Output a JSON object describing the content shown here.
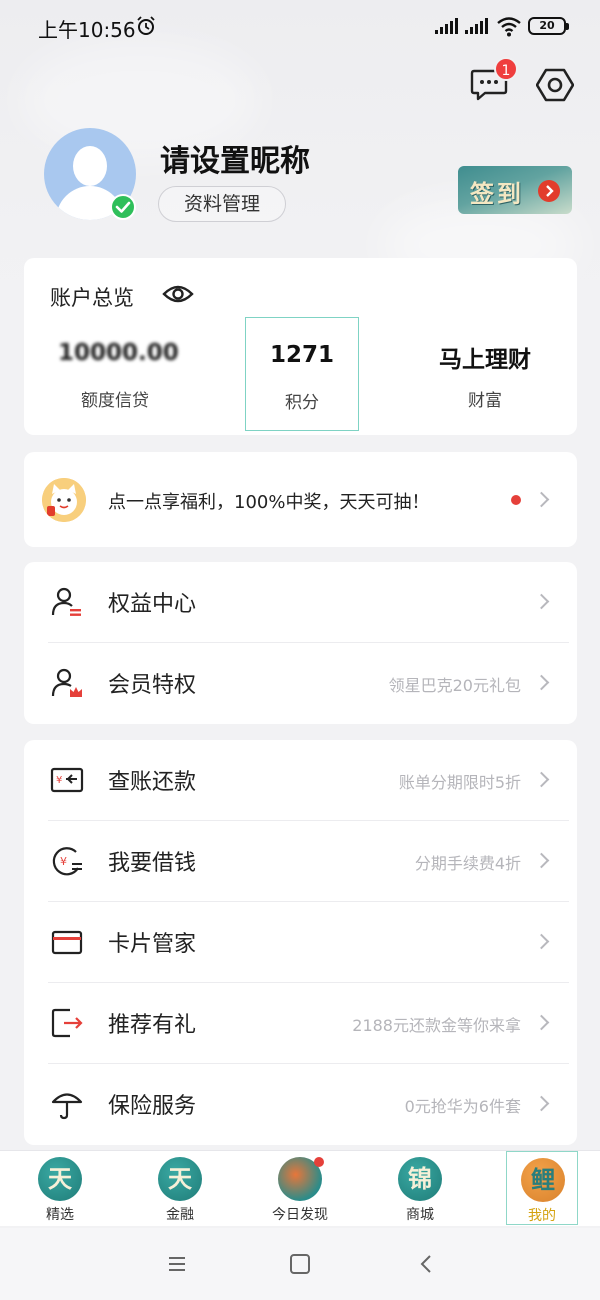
{
  "status_bar": {
    "time": "上午10:56",
    "battery": "20"
  },
  "header": {
    "message_badge": "1"
  },
  "profile": {
    "nickname": "请设置昵称",
    "profile_button": "资料管理",
    "checkin_label": "签到"
  },
  "overview": {
    "title": "账户总览",
    "stats": [
      {
        "value": "10000.00",
        "label": "额度信贷"
      },
      {
        "value": "1271",
        "label": "积分"
      },
      {
        "value": "马上理财",
        "label": "财富"
      }
    ]
  },
  "promo": {
    "text": "点一点享福利，100%中奖，天天可抽！"
  },
  "rights": [
    {
      "label": "权益中心",
      "hint": ""
    },
    {
      "label": "会员特权",
      "hint": "领星巴克20元礼包"
    }
  ],
  "services": [
    {
      "label": "查账还款",
      "hint": "账单分期限时5折"
    },
    {
      "label": "我要借钱",
      "hint": "分期手续费4折"
    },
    {
      "label": "卡片管家",
      "hint": ""
    },
    {
      "label": "推荐有礼",
      "hint": "2188元还款金等你来拿"
    },
    {
      "label": "保险服务",
      "hint": "0元抢华为6件套"
    }
  ],
  "tabs": [
    {
      "label": "精选",
      "glyph": "天"
    },
    {
      "label": "金融",
      "glyph": "天"
    },
    {
      "label": "今日发现",
      "glyph": ""
    },
    {
      "label": "商城",
      "glyph": "锦"
    },
    {
      "label": "我的",
      "glyph": "鲤"
    }
  ],
  "colors": {
    "accent_teal": "#2e8c8c",
    "badge_red": "#ef3e3e",
    "active_tab": "#d4a20f",
    "hint_gray": "#b5b5ba"
  }
}
